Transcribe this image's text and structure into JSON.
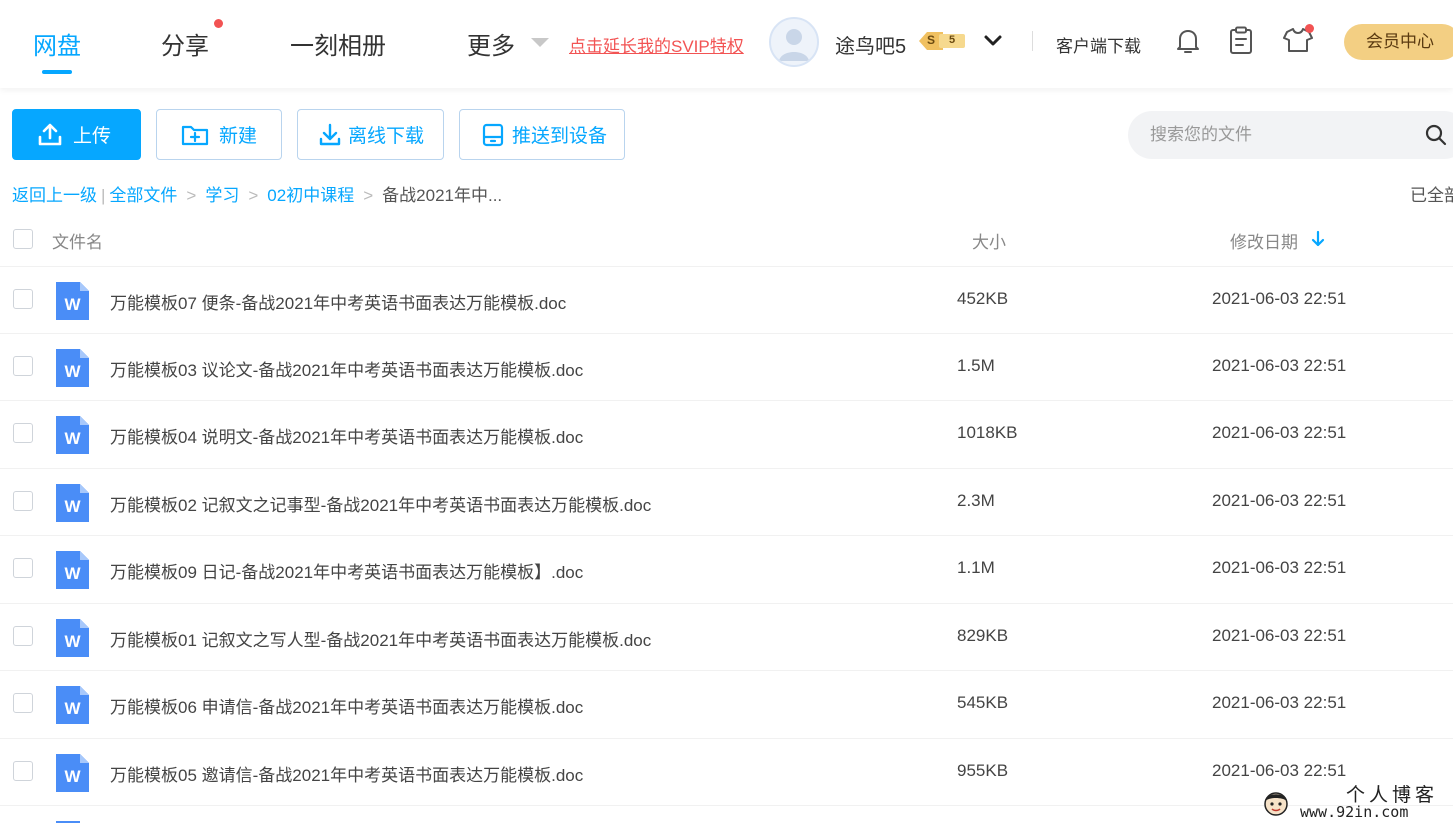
{
  "nav": {
    "tabs": [
      {
        "label": "网盘",
        "active": true
      },
      {
        "label": "分享",
        "has_dot": true
      },
      {
        "label": "一刻相册"
      },
      {
        "label": "更多"
      }
    ],
    "svip_link": "点击延长我的SVIP特权",
    "username": "途鸟吧5",
    "vip_badge": {
      "left": "S",
      "right": "5"
    },
    "client_download": "客户端下载",
    "member_center": "会员中心",
    "icons": [
      "bell-icon",
      "clipboard-icon",
      "tshirt-icon"
    ],
    "colors": {
      "accent": "#06a7ff",
      "alert": "#f25353",
      "member": "#f3cf83"
    }
  },
  "toolbar": {
    "upload": "上传",
    "new": "新建",
    "offline_download": "离线下载",
    "push_to_device": "推送到设备"
  },
  "search": {
    "placeholder": "搜索您的文件"
  },
  "breadcrumb": {
    "back": "返回上一级",
    "items": [
      "全部文件",
      "学习",
      "02初中课程"
    ],
    "current": "备战2021年中..."
  },
  "loaded_status": "已全部",
  "table": {
    "headers": {
      "name": "文件名",
      "size": "大小",
      "modified": "修改日期"
    },
    "sort": {
      "column": "modified",
      "direction": "desc"
    },
    "rows": [
      {
        "name": "万能模板07 便条-备战2021年中考英语书面表达万能模板.doc",
        "size": "452KB",
        "date": "2021-06-03 22:51",
        "type": "word-doc-icon"
      },
      {
        "name": "万能模板03 议论文-备战2021年中考英语书面表达万能模板.doc",
        "size": "1.5M",
        "date": "2021-06-03 22:51",
        "type": "word-doc-icon"
      },
      {
        "name": "万能模板04 说明文-备战2021年中考英语书面表达万能模板.doc",
        "size": "1018KB",
        "date": "2021-06-03 22:51",
        "type": "word-doc-icon"
      },
      {
        "name": "万能模板02 记叙文之记事型-备战2021年中考英语书面表达万能模板.doc",
        "size": "2.3M",
        "date": "2021-06-03 22:51",
        "type": "word-doc-icon"
      },
      {
        "name": "万能模板09 日记-备战2021年中考英语书面表达万能模板】.doc",
        "size": "1.1M",
        "date": "2021-06-03 22:51",
        "type": "word-doc-icon"
      },
      {
        "name": "万能模板01 记叙文之写人型-备战2021年中考英语书面表达万能模板.doc",
        "size": "829KB",
        "date": "2021-06-03 22:51",
        "type": "word-doc-icon"
      },
      {
        "name": "万能模板06 申请信-备战2021年中考英语书面表达万能模板.doc",
        "size": "545KB",
        "date": "2021-06-03 22:51",
        "type": "word-doc-icon"
      },
      {
        "name": "万能模板05 邀请信-备战2021年中考英语书面表达万能模板.doc",
        "size": "955KB",
        "date": "2021-06-03 22:51",
        "type": "word-doc-icon"
      }
    ]
  },
  "watermark": {
    "title": "个人博客",
    "url": "www.92in.com"
  }
}
